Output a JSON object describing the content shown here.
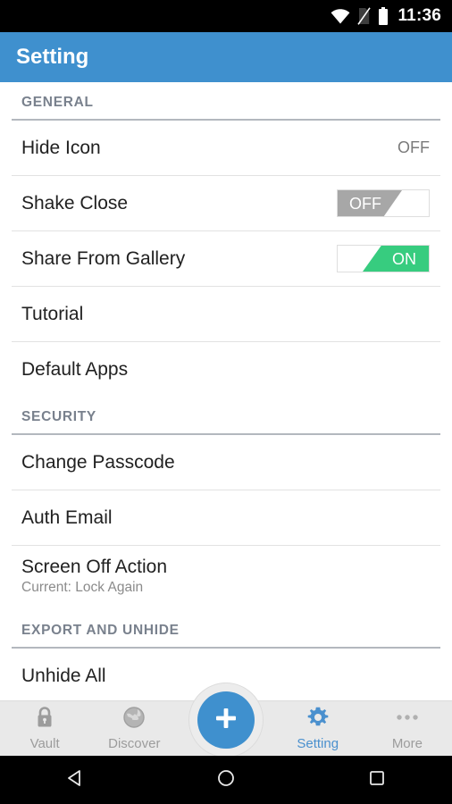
{
  "status_bar": {
    "time": "11:36",
    "icons": [
      "wifi-icon",
      "sim-no-signal-icon",
      "battery-icon"
    ]
  },
  "action_bar": {
    "title": "Setting",
    "background_color": "#3f90ce"
  },
  "colors": {
    "accent_blue": "#3f90ce",
    "toggle_on_green": "#37cc7f",
    "toggle_off_gray": "#a7a7a7",
    "section_header_text": "#79818d",
    "divider": "#e2e2e2"
  },
  "sections": [
    {
      "header": "GENERAL",
      "rows": [
        {
          "title": "Hide Icon",
          "control": "text",
          "value": "OFF"
        },
        {
          "title": "Shake Close",
          "control": "toggle",
          "value": "OFF",
          "state": "off"
        },
        {
          "title": "Share From Gallery",
          "control": "toggle",
          "value": "ON",
          "state": "on"
        },
        {
          "title": "Tutorial",
          "control": "none"
        },
        {
          "title": "Default Apps",
          "control": "none"
        }
      ]
    },
    {
      "header": "SECURITY",
      "rows": [
        {
          "title": "Change Passcode",
          "control": "none"
        },
        {
          "title": "Auth Email",
          "control": "none"
        },
        {
          "title": "Screen Off Action",
          "control": "none",
          "subtitle": "Current: Lock Again"
        }
      ]
    },
    {
      "header": "EXPORT AND UNHIDE",
      "rows": [
        {
          "title": "Unhide All",
          "control": "none"
        }
      ]
    }
  ],
  "tab_bar": {
    "tabs": [
      {
        "label": "Vault",
        "icon": "lock-icon",
        "active": false
      },
      {
        "label": "Discover",
        "icon": "globe-icon",
        "active": false
      },
      {
        "label": "Setting",
        "icon": "gear-icon",
        "active": true
      },
      {
        "label": "More",
        "icon": "ellipsis-icon",
        "active": false
      }
    ],
    "fab": {
      "icon": "plus-icon",
      "color": "#3f90ce"
    }
  },
  "nav_bar": {
    "buttons": [
      {
        "name": "back-button",
        "icon": "triangle-left-icon"
      },
      {
        "name": "home-button",
        "icon": "circle-icon"
      },
      {
        "name": "recents-button",
        "icon": "square-icon"
      }
    ]
  }
}
